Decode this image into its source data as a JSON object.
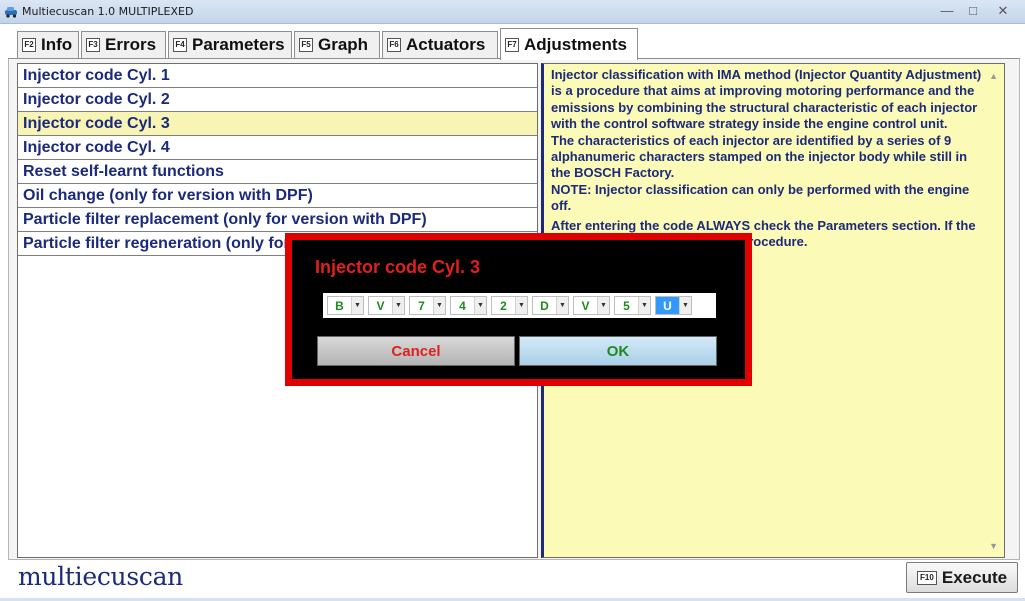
{
  "window": {
    "title": "Multiecuscan 1.0 MULTIPLEXED",
    "controls": {
      "minimize": "—",
      "maximize": "□",
      "close": "✕"
    }
  },
  "tabs": [
    {
      "key": "F2",
      "label": "Info",
      "active": false
    },
    {
      "key": "F3",
      "label": "Errors",
      "active": false
    },
    {
      "key": "F4",
      "label": "Parameters",
      "active": false
    },
    {
      "key": "F5",
      "label": "Graph",
      "active": false
    },
    {
      "key": "F6",
      "label": "Actuators",
      "active": false
    },
    {
      "key": "F7",
      "label": "Adjustments",
      "active": true
    }
  ],
  "functions": [
    {
      "label": "Injector code Cyl. 1",
      "selected": false
    },
    {
      "label": "Injector code Cyl. 2",
      "selected": false
    },
    {
      "label": "Injector code Cyl. 3",
      "selected": true
    },
    {
      "label": "Injector code Cyl. 4",
      "selected": false
    },
    {
      "label": "Reset self-learnt functions",
      "selected": false
    },
    {
      "label": "Oil change (only for version with DPF)",
      "selected": false
    },
    {
      "label": "Particle filter replacement (only for version with DPF)",
      "selected": false
    },
    {
      "label": "Particle filter regeneration (only for version with DPF)",
      "selected": false
    }
  ],
  "description": {
    "lines": [
      "Injector classification with IMA method (Injector Quantity Adjustment) is a procedure that aims at improving motoring performance and the emissions by combining the structural characteristic of each injector with the control software strategy inside the engine control unit.",
      "The characteristics of each injector are identified by a series of 9 alphanumeric characters stamped on the injector body while still in the BOSCH Factory.",
      "NOTE: Injector classification can only be performed with the engine off.",
      "After entering the code ALWAYS check the Parameters section. If the code is not correct, repeat the procedure."
    ]
  },
  "dialog": {
    "title": "Injector code Cyl. 3",
    "code": [
      "B",
      "V",
      "7",
      "4",
      "2",
      "D",
      "V",
      "5",
      "U"
    ],
    "highlighted_index": 8,
    "cancel_label": "Cancel",
    "ok_label": "OK"
  },
  "footer": {
    "logo": "multiecuscan",
    "execute_key": "F10",
    "execute_label": "Execute"
  },
  "colors": {
    "list_text": "#1b2a7a",
    "selected_row": "#f8f4b4",
    "description_bg": "#fbfab7",
    "dialog_border": "#e00000",
    "dialog_title": "#e02020",
    "code_text": "#1f8a1f",
    "code_highlight": "#3399ff"
  }
}
